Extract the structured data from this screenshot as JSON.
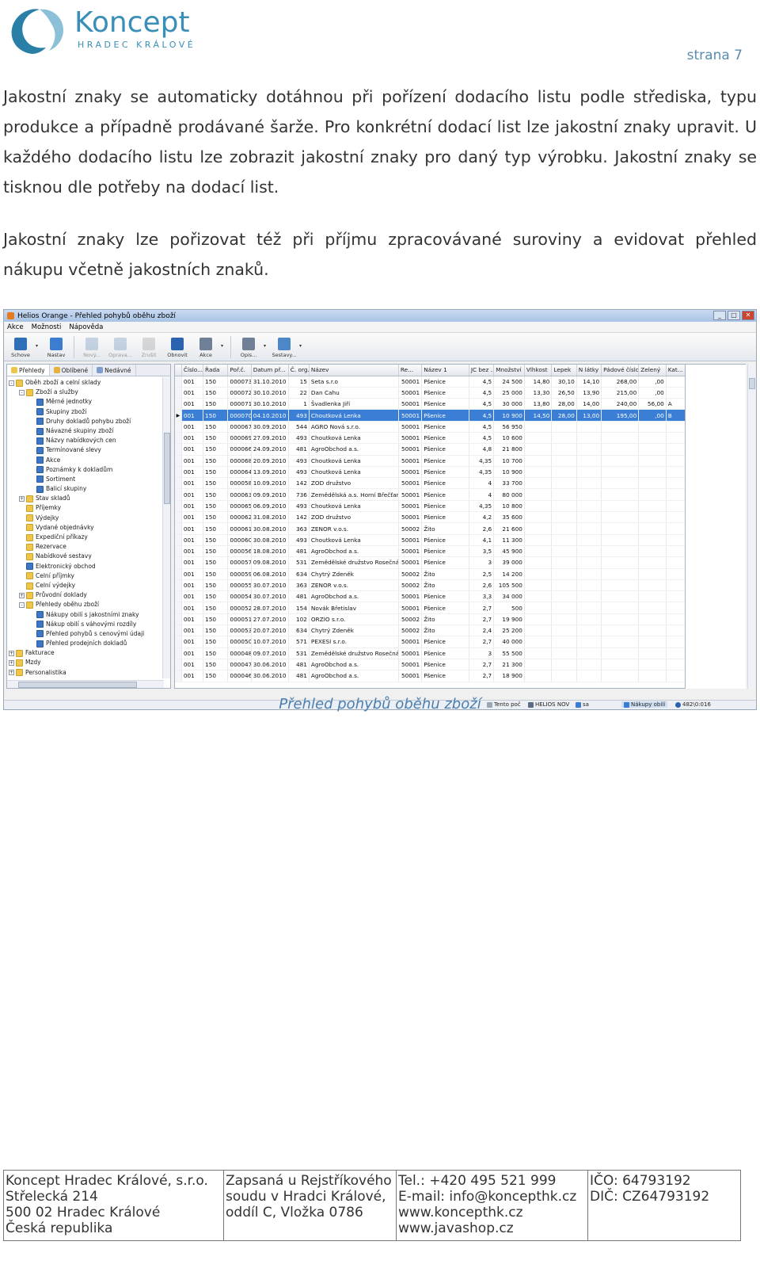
{
  "header": {
    "logo_name": "Koncept",
    "logo_sub": "HRADEC KRÁLOVÉ",
    "page_number": "strana 7"
  },
  "paragraphs": [
    "Jakostní znaky se automaticky dotáhnou při pořízení dodacího listu podle střediska, typu produkce a případně prodávané šarže. Pro konkrétní dodací list lze jakostní znaky upravit. U každého dodacího listu lze zobrazit jakostní znaky pro daný typ výrobku. Jakostní znaky se tisknou dle potřeby na dodací list.",
    "Jakostní znaky lze pořizovat též při příjmu zpracovávané suroviny a evidovat přehled nákupu včetně jakostních znaků."
  ],
  "app": {
    "title": "Helios Orange - Přehled pohybů oběhu zboží",
    "window_buttons": [
      "_",
      "□",
      "✕"
    ],
    "menu": [
      "Akce",
      "Možnosti",
      "Nápověda"
    ],
    "toolbar": [
      {
        "label": "Schove",
        "icon": "save-icon",
        "color": "#2f6fb8",
        "enabled": true,
        "dropdown": true
      },
      {
        "label": "Nastav",
        "icon": "search-icon",
        "color": "#3b7dd0",
        "enabled": true,
        "dropdown": false
      },
      {
        "label": "Nový...",
        "icon": "new-icon",
        "color": "#8aa6c8",
        "enabled": false,
        "dropdown": false
      },
      {
        "label": "Oprava...",
        "icon": "edit-icon",
        "color": "#8aa6c8",
        "enabled": false,
        "dropdown": false
      },
      {
        "label": "Zrušit",
        "icon": "delete-icon",
        "color": "#b0b0b0",
        "enabled": false,
        "dropdown": false
      },
      {
        "label": "Obnovit",
        "icon": "refresh-icon",
        "color": "#2a62b0",
        "enabled": true,
        "dropdown": false
      },
      {
        "label": "Akce",
        "icon": "action-icon",
        "color": "#6f7f95",
        "enabled": true,
        "dropdown": true
      },
      {
        "label": "Opis...",
        "icon": "print-icon",
        "color": "#6f7f95",
        "enabled": true,
        "dropdown": true
      },
      {
        "label": "Sestavy...",
        "icon": "report-icon",
        "color": "#4c88c8",
        "enabled": true,
        "dropdown": true
      }
    ],
    "left_tabs": [
      {
        "label": "Přehledy",
        "color": "#f0c64a",
        "active": true
      },
      {
        "label": "Oblíbené",
        "color": "#e2b23a",
        "active": false
      },
      {
        "label": "Nedávné",
        "color": "#7f9ccf",
        "active": false
      }
    ],
    "tree": [
      {
        "label": "Oběh zboží a celní sklady",
        "level": 0,
        "exp": "-",
        "kind": "folder"
      },
      {
        "label": "Zboží a služby",
        "level": 1,
        "exp": "-",
        "kind": "folder"
      },
      {
        "label": "Měrné jednotky",
        "level": 2,
        "exp": "",
        "kind": "book"
      },
      {
        "label": "Skupiny zboží",
        "level": 2,
        "exp": "",
        "kind": "book"
      },
      {
        "label": "Druhy dokladů pohybu zboží",
        "level": 2,
        "exp": "",
        "kind": "book"
      },
      {
        "label": "Návazné skupiny zboží",
        "level": 2,
        "exp": "",
        "kind": "book"
      },
      {
        "label": "Názvy nabídkových cen",
        "level": 2,
        "exp": "",
        "kind": "book"
      },
      {
        "label": "Termínované slevy",
        "level": 2,
        "exp": "",
        "kind": "book"
      },
      {
        "label": "Akce",
        "level": 2,
        "exp": "",
        "kind": "book"
      },
      {
        "label": "Poznámky k dokladům",
        "level": 2,
        "exp": "",
        "kind": "book"
      },
      {
        "label": "Sortiment",
        "level": 2,
        "exp": "",
        "kind": "book"
      },
      {
        "label": "Balicí skupiny",
        "level": 2,
        "exp": "",
        "kind": "book"
      },
      {
        "label": "Stav skladů",
        "level": 1,
        "exp": "+",
        "kind": "folder"
      },
      {
        "label": "Příjemky",
        "level": 1,
        "exp": "",
        "kind": "folder"
      },
      {
        "label": "Výdejky",
        "level": 1,
        "exp": "",
        "kind": "folder"
      },
      {
        "label": "Vydané objednávky",
        "level": 1,
        "exp": "",
        "kind": "folder"
      },
      {
        "label": "Expediční příkazy",
        "level": 1,
        "exp": "",
        "kind": "folder"
      },
      {
        "label": "Rezervace",
        "level": 1,
        "exp": "",
        "kind": "folder"
      },
      {
        "label": "Nabídkové sestavy",
        "level": 1,
        "exp": "",
        "kind": "folder"
      },
      {
        "label": "Elektronický obchod",
        "level": 1,
        "exp": "",
        "kind": "book"
      },
      {
        "label": "Celní příjmky",
        "level": 1,
        "exp": "",
        "kind": "folder"
      },
      {
        "label": "Celní výdejky",
        "level": 1,
        "exp": "",
        "kind": "folder"
      },
      {
        "label": "Průvodní doklady",
        "level": 1,
        "exp": "+",
        "kind": "folder"
      },
      {
        "label": "Přehledy oběhu zboží",
        "level": 1,
        "exp": "-",
        "kind": "folder"
      },
      {
        "label": "Nákupy obilí s jakostními znaky",
        "level": 2,
        "exp": "",
        "kind": "book"
      },
      {
        "label": "Nákup obilí s váhovými rozdíly",
        "level": 2,
        "exp": "",
        "kind": "book"
      },
      {
        "label": "Přehled pohybů s cenovými údaji",
        "level": 2,
        "exp": "",
        "kind": "book"
      },
      {
        "label": "Přehled prodejních dokladů",
        "level": 2,
        "exp": "",
        "kind": "book"
      },
      {
        "label": "Fakturace",
        "level": 0,
        "exp": "+",
        "kind": "folder"
      },
      {
        "label": "Mzdy",
        "level": 0,
        "exp": "+",
        "kind": "folder"
      },
      {
        "label": "Personalistika",
        "level": 0,
        "exp": "+",
        "kind": "folder"
      }
    ],
    "grid": {
      "columns": [
        "Číslo...",
        "Řada",
        "Poř.č.",
        "Datum př...",
        "Č. org.",
        "Název",
        "Re...",
        "Název 1",
        "JC bez ...",
        "Množství",
        "Vlhkost",
        "Lepek",
        "N látky",
        "Pádové číslo",
        "Zelený",
        "Kat..."
      ],
      "rows": [
        [
          "001",
          "150",
          "000073",
          "31.10.2010",
          "15",
          "Seta s.r.o",
          "50001",
          "Pšenice",
          "4,5",
          "24 500",
          "14,80",
          "30,10",
          "14,10",
          "268,00",
          ",00",
          ""
        ],
        [
          "001",
          "150",
          "000072",
          "30.10.2010",
          "22",
          "Dan Cahu",
          "50001",
          "Pšenice",
          "4,5",
          "25 000",
          "13,30",
          "26,50",
          "13,90",
          "215,00",
          ",00",
          ""
        ],
        [
          "001",
          "150",
          "000071",
          "30.10.2010",
          "1",
          "Švadlenka Jiří",
          "50001",
          "Pšenice",
          "4,5",
          "30 000",
          "13,80",
          "28,00",
          "14,00",
          "240,00",
          "56,00",
          "A"
        ],
        [
          "001",
          "150",
          "000070",
          "04.10.2010",
          "493",
          "Choutková Lenka",
          "50001",
          "Pšenice",
          "4,5",
          "10 900",
          "14,50",
          "28,00",
          "13,00",
          "195,00",
          ",00",
          "B"
        ],
        [
          "001",
          "150",
          "000067",
          "30.09.2010",
          "544",
          "AGRO Nová s.r.o.",
          "50001",
          "Pšenice",
          "4,5",
          "56 950",
          "",
          "",
          "",
          "",
          "",
          ""
        ],
        [
          "001",
          "150",
          "000069",
          "27.09.2010",
          "493",
          "Choutková Lenka",
          "50001",
          "Pšenice",
          "4,5",
          "10 600",
          "",
          "",
          "",
          "",
          "",
          ""
        ],
        [
          "001",
          "150",
          "000066",
          "24.09.2010",
          "481",
          "AgroObchod a.s.",
          "50001",
          "Pšenice",
          "4,8",
          "21 800",
          "",
          "",
          "",
          "",
          "",
          ""
        ],
        [
          "001",
          "150",
          "000068",
          "20.09.2010",
          "493",
          "Choutková Lenka",
          "50001",
          "Pšenice",
          "4,35",
          "10 700",
          "",
          "",
          "",
          "",
          "",
          ""
        ],
        [
          "001",
          "150",
          "000064",
          "13.09.2010",
          "493",
          "Choutková Lenka",
          "50001",
          "Pšenice",
          "4,35",
          "10 900",
          "",
          "",
          "",
          "",
          "",
          ""
        ],
        [
          "001",
          "150",
          "000058",
          "10.09.2010",
          "142",
          "ZOD družstvo",
          "50001",
          "Pšenice",
          "4",
          "33 700",
          "",
          "",
          "",
          "",
          "",
          ""
        ],
        [
          "001",
          "150",
          "000063",
          "09.09.2010",
          "736",
          "Zemědělská a.s. Horní Břečťan",
          "50001",
          "Pšenice",
          "4",
          "80 000",
          "",
          "",
          "",
          "",
          "",
          ""
        ],
        [
          "001",
          "150",
          "000065",
          "06.09.2010",
          "493",
          "Choutková Lenka",
          "50001",
          "Pšenice",
          "4,35",
          "10 800",
          "",
          "",
          "",
          "",
          "",
          ""
        ],
        [
          "001",
          "150",
          "000062",
          "31.08.2010",
          "142",
          "ZOD družstvo",
          "50001",
          "Pšenice",
          "4,2",
          "35 600",
          "",
          "",
          "",
          "",
          "",
          ""
        ],
        [
          "001",
          "150",
          "000061",
          "30.08.2010",
          "363",
          "ZENOR v.o.s.",
          "50002",
          "Žito",
          "2,6",
          "21 600",
          "",
          "",
          "",
          "",
          "",
          ""
        ],
        [
          "001",
          "150",
          "000060",
          "30.08.2010",
          "493",
          "Choutková Lenka",
          "50001",
          "Pšenice",
          "4,1",
          "11 300",
          "",
          "",
          "",
          "",
          "",
          ""
        ],
        [
          "001",
          "150",
          "000056",
          "18.08.2010",
          "481",
          "AgroObchod a.s.",
          "50001",
          "Pšenice",
          "3,5",
          "45 900",
          "",
          "",
          "",
          "",
          "",
          ""
        ],
        [
          "001",
          "150",
          "000057",
          "09.08.2010",
          "531",
          "Zemědělské družstvo Rosečná",
          "50001",
          "Pšenice",
          "3",
          "39 000",
          "",
          "",
          "",
          "",
          "",
          ""
        ],
        [
          "001",
          "150",
          "000059",
          "06.08.2010",
          "634",
          "Chytrý Zdeněk",
          "50002",
          "Žito",
          "2,5",
          "14 200",
          "",
          "",
          "",
          "",
          "",
          ""
        ],
        [
          "001",
          "150",
          "000055",
          "30.07.2010",
          "363",
          "ZENOR v.o.s.",
          "50002",
          "Žito",
          "2,6",
          "105 500",
          "",
          "",
          "",
          "",
          "",
          ""
        ],
        [
          "001",
          "150",
          "000054",
          "30.07.2010",
          "481",
          "AgroObchod a.s.",
          "50001",
          "Pšenice",
          "3,3",
          "34 000",
          "",
          "",
          "",
          "",
          "",
          ""
        ],
        [
          "001",
          "150",
          "000052",
          "28.07.2010",
          "154",
          "Novák Břetislav",
          "50001",
          "Pšenice",
          "2,7",
          "500",
          "",
          "",
          "",
          "",
          "",
          ""
        ],
        [
          "001",
          "150",
          "000051",
          "27.07.2010",
          "102",
          "ORZIO s.r.o.",
          "50002",
          "Žito",
          "2,7",
          "19 900",
          "",
          "",
          "",
          "",
          "",
          ""
        ],
        [
          "001",
          "150",
          "000053",
          "20.07.2010",
          "634",
          "Chytrý Zdeněk",
          "50002",
          "Žito",
          "2,4",
          "25 200",
          "",
          "",
          "",
          "",
          "",
          ""
        ],
        [
          "001",
          "150",
          "000050",
          "10.07.2010",
          "571",
          "PEXESI s.r.o.",
          "50001",
          "Pšenice",
          "2,7",
          "40 000",
          "",
          "",
          "",
          "",
          "",
          ""
        ],
        [
          "001",
          "150",
          "000048",
          "09.07.2010",
          "531",
          "Zemědělské družstvo Rosečná",
          "50001",
          "Pšenice",
          "3",
          "55 500",
          "",
          "",
          "",
          "",
          "",
          ""
        ],
        [
          "001",
          "150",
          "000047",
          "30.06.2010",
          "481",
          "AgroObchod a.s.",
          "50001",
          "Pšenice",
          "2,7",
          "21 300",
          "",
          "",
          "",
          "",
          "",
          ""
        ],
        [
          "001",
          "150",
          "000046",
          "30.06.2010",
          "481",
          "AgroObchod a.s.",
          "50001",
          "Pšenice",
          "2,7",
          "18 900",
          "",
          "",
          "",
          "",
          "",
          ""
        ]
      ],
      "selected_row": 3
    },
    "status": {
      "s1": "Tento poč",
      "s2": "HELIOS NOV",
      "s3": "sa",
      "s4": "Nákupy obilí",
      "s5": "482\\0:016"
    }
  },
  "caption": "Přehled pohybů oběhu zboží",
  "footer": {
    "col1": [
      "Koncept Hradec Králové, s.r.o.",
      "Střelecká 214",
      "500 02 Hradec Králové",
      "Česká republika"
    ],
    "col2": [
      "Zapsaná u Rejstříkového",
      "soudu v Hradci Králové,",
      "oddíl C, Vložka 0786"
    ],
    "col3": [
      "Tel.: +420 495 521 999",
      "E-mail: info@koncepthk.cz",
      "www.koncepthk.cz",
      "www.javashop.cz"
    ],
    "col4": [
      "IČO: 64793192",
      "DIČ: CZ64793192"
    ]
  },
  "colors": {
    "accent": "#5a8db0",
    "logo_teal": "#2a7fa6",
    "selection": "#3a7fd5"
  }
}
